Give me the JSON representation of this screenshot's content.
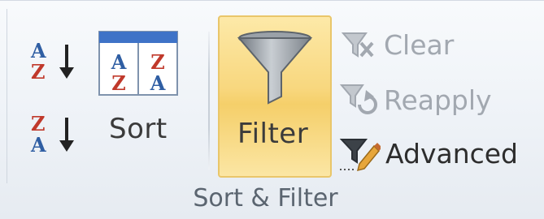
{
  "ribbon_group": {
    "sort_ascending_icon_letters": [
      "A",
      "Z"
    ],
    "sort_descending_icon_letters": [
      "Z",
      "A"
    ],
    "sort_label": "Sort",
    "filter_label": "Filter",
    "clear_label": "Clear",
    "reapply_label": "Reapply",
    "advanced_label": "Advanced",
    "group_label": "Sort & Filter"
  },
  "colors": {
    "filter_highlight": "#f8d77e",
    "sort_blue": "#2f5ea3",
    "sort_red": "#c0392b"
  }
}
